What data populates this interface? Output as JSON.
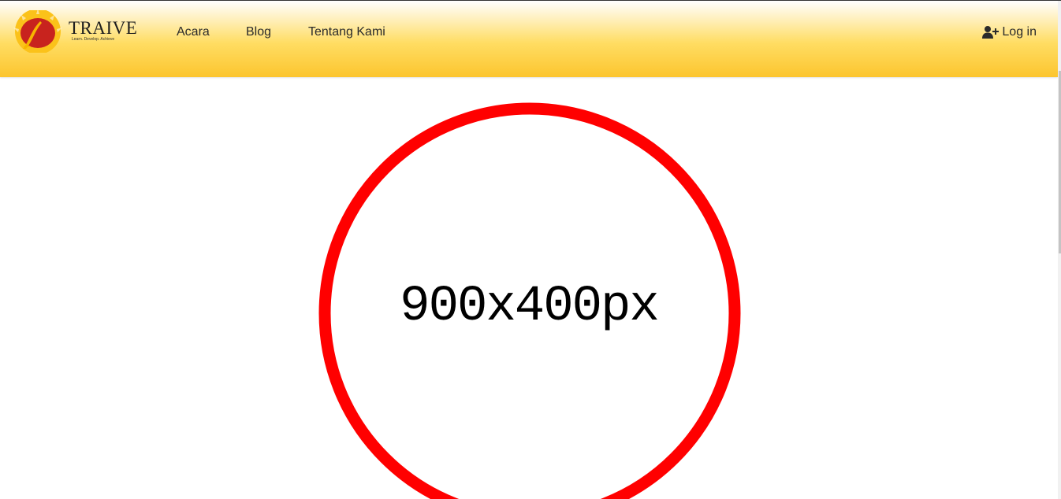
{
  "brand": {
    "name": "TRAIVE",
    "tagline": "Learn. Develop. Achieve"
  },
  "nav": {
    "items": [
      {
        "label": "Acara"
      },
      {
        "label": "Blog"
      },
      {
        "label": "Tentang Kami"
      }
    ],
    "login_label": "Log in",
    "login_icon": "user-plus-icon"
  },
  "hero": {
    "placeholder_text": "900x400px"
  },
  "colors": {
    "navbar_gradient_top": "#ffffff",
    "navbar_gradient_bottom": "#fcc52e",
    "placeholder_ring": "#ff0000",
    "logo_disc": "#c8231e",
    "logo_rays": "#f7b500"
  }
}
